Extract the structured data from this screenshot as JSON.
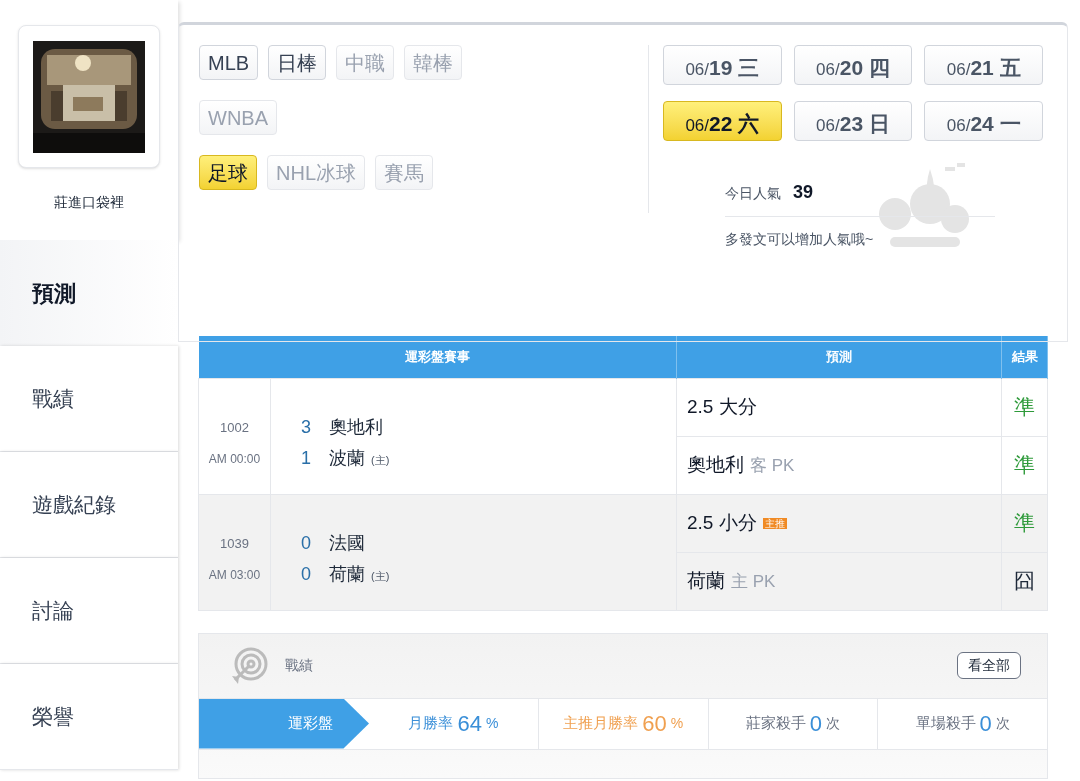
{
  "profile": {
    "name": "莊進口袋裡"
  },
  "sidebar": {
    "items": [
      {
        "label": "預測",
        "selected": true
      },
      {
        "label": "戰績",
        "selected": false
      },
      {
        "label": "遊戲紀錄",
        "selected": false
      },
      {
        "label": "討論",
        "selected": false
      },
      {
        "label": "榮譽",
        "selected": false
      }
    ]
  },
  "sports": [
    [
      {
        "label": "MLB",
        "selected": false,
        "disabled": false
      },
      {
        "label": "日棒",
        "selected": false,
        "disabled": false
      },
      {
        "label": "中職",
        "selected": false,
        "disabled": true
      },
      {
        "label": "韓棒",
        "selected": false,
        "disabled": true
      }
    ],
    [
      {
        "label": "WNBA",
        "selected": false,
        "disabled": true
      }
    ],
    [
      {
        "label": "足球",
        "selected": true,
        "disabled": false
      },
      {
        "label": "NHL冰球",
        "selected": false,
        "disabled": true
      },
      {
        "label": "賽馬",
        "selected": false,
        "disabled": true
      }
    ]
  ],
  "dates": [
    {
      "month": "06/",
      "day": "19 三",
      "selected": false
    },
    {
      "month": "06/",
      "day": "20 四",
      "selected": false
    },
    {
      "month": "06/",
      "day": "21 五",
      "selected": false
    },
    {
      "month": "06/",
      "day": "22 六",
      "selected": true
    },
    {
      "month": "06/",
      "day": "23 日",
      "selected": false
    },
    {
      "month": "06/",
      "day": "24 一",
      "selected": false
    }
  ],
  "popularity": {
    "label": "今日人氣",
    "value": "39",
    "hint": "多發文可以增加人氣哦~"
  },
  "table": {
    "columns": [
      "運彩盤賽事",
      "預測",
      "結果"
    ],
    "rows": [
      {
        "id": "1002",
        "time": "AM 00:00",
        "teams": [
          {
            "score": "3",
            "name": "奧地利"
          },
          {
            "score": "1",
            "name": "波蘭",
            "home": "(主)"
          }
        ],
        "picks": [
          {
            "pick": "2.5 大分",
            "result": "準",
            "kind": "hit"
          },
          {
            "pick": "奧地利",
            "note": "客 PK",
            "result": "準",
            "kind": "hit"
          }
        ]
      },
      {
        "id": "1039",
        "time": "AM 03:00",
        "teams": [
          {
            "score": "0",
            "name": "法國"
          },
          {
            "score": "0",
            "name": "荷蘭",
            "home": "(主)"
          }
        ],
        "picks": [
          {
            "pick": "2.5 小分",
            "badge": "主推",
            "result": "準",
            "kind": "hit"
          },
          {
            "pick": "荷蘭",
            "note": "主 PK",
            "result": "囧",
            "kind": "miss"
          }
        ]
      }
    ]
  },
  "record": {
    "title": "戰績",
    "button": "看全部",
    "tab": "運彩盤",
    "stats": [
      {
        "label": "月勝率",
        "value": "64",
        "unit": "%",
        "kind": "rate"
      },
      {
        "label": "主推月勝率",
        "value": "60",
        "unit": "%",
        "kind": "featured"
      },
      {
        "label": "莊家殺手",
        "value": "0",
        "unit": "次",
        "kind": "count"
      },
      {
        "label": "單場殺手",
        "value": "0",
        "unit": "次",
        "kind": "count"
      }
    ]
  }
}
